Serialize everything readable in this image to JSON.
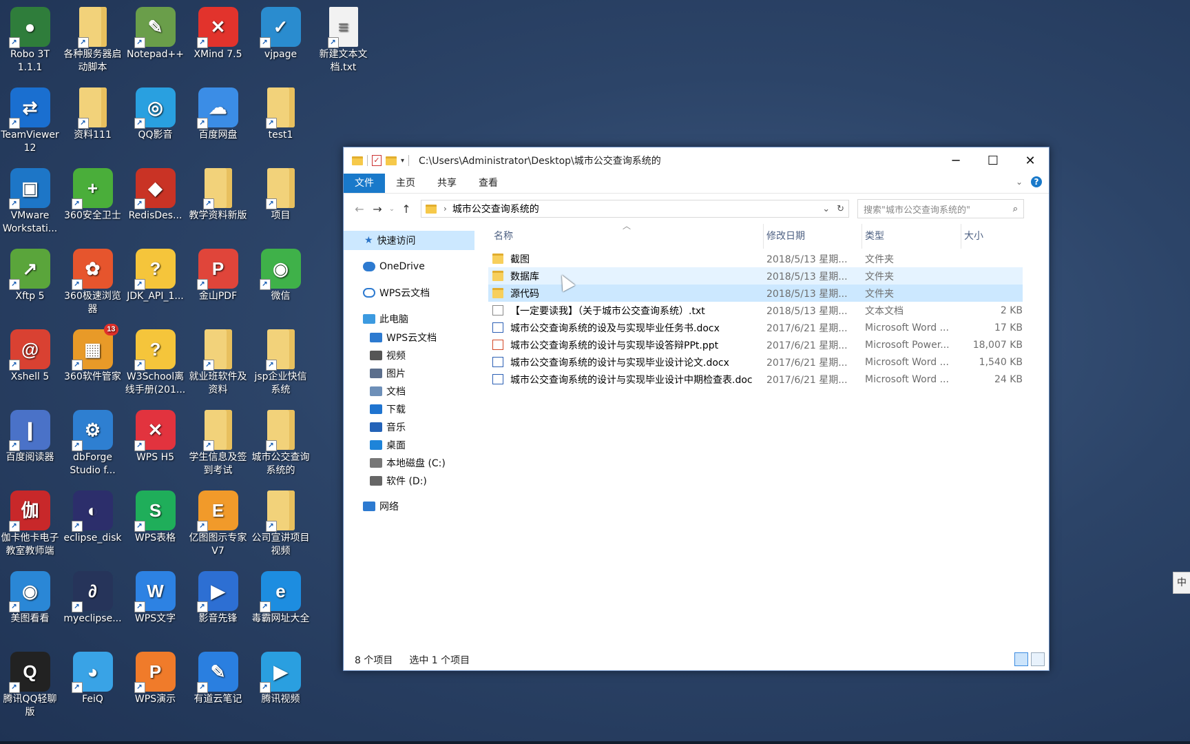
{
  "desktop": {
    "icons": [
      {
        "label": "Robo 3T\n1.1.1",
        "color": "#2f7d3b",
        "glyph": "●"
      },
      {
        "label": "各种服务器启\n动脚本",
        "color": "#f2d27a",
        "glyph": "",
        "folder": true
      },
      {
        "label": "Notepad++",
        "color": "#6a9e4a",
        "glyph": "✎"
      },
      {
        "label": "XMind 7.5",
        "color": "#e2332c",
        "glyph": "✕"
      },
      {
        "label": "vjpage",
        "color": "#2a8ccf",
        "glyph": "✓"
      },
      {
        "label": "新建文本文\n档.txt",
        "color": "#f2f2f2",
        "glyph": "≡",
        "file": true
      },
      {
        "label": "TeamViewer\n12",
        "color": "#1a6fd0",
        "glyph": "⇄"
      },
      {
        "label": "资料111",
        "color": "#f2d27a",
        "glyph": "",
        "folder": true
      },
      {
        "label": "QQ影音",
        "color": "#29a0e0",
        "glyph": "◎"
      },
      {
        "label": "百度网盘",
        "color": "#3b8de6",
        "glyph": "☁"
      },
      {
        "label": "test1",
        "color": "#f2d27a",
        "glyph": "",
        "folder": true
      },
      {
        "label": "VMware\nWorkstati...",
        "color": "#1d76c7",
        "glyph": "▣"
      },
      {
        "label": "360安全卫士",
        "color": "#4aae3a",
        "glyph": "+"
      },
      {
        "label": "RedisDes...",
        "color": "#c93325",
        "glyph": "◆"
      },
      {
        "label": "教学资料新版",
        "color": "#f2d27a",
        "glyph": "",
        "folder": true
      },
      {
        "label": "项目",
        "color": "#f2d27a",
        "glyph": "",
        "folder": true
      },
      {
        "label": "Xftp 5",
        "color": "#5aa53b",
        "glyph": "↗"
      },
      {
        "label": "360极速浏览\n器",
        "color": "#e6552d",
        "glyph": "✿"
      },
      {
        "label": "JDK_API_1...",
        "color": "#f5c53b",
        "glyph": "?"
      },
      {
        "label": "金山PDF",
        "color": "#e0453a",
        "glyph": "P"
      },
      {
        "label": "微信",
        "color": "#3fb149",
        "glyph": "◉"
      },
      {
        "label": "Xshell 5",
        "color": "#d94132",
        "glyph": "@"
      },
      {
        "label": "360软件管家",
        "color": "#e89a28",
        "glyph": "▦",
        "badge": "13"
      },
      {
        "label": "W3School离\n线手册(201...",
        "color": "#f5c53b",
        "glyph": "?"
      },
      {
        "label": "就业班软件及\n资料",
        "color": "#f2d27a",
        "glyph": "",
        "folder": true
      },
      {
        "label": "jsp企业快信\n系统",
        "color": "#f2d27a",
        "glyph": "",
        "folder": true
      },
      {
        "label": "百度阅读器",
        "color": "#4a72c8",
        "glyph": "❙"
      },
      {
        "label": "dbForge\nStudio f...",
        "color": "#2e7fd1",
        "glyph": "⚙"
      },
      {
        "label": "WPS H5",
        "color": "#e2333e",
        "glyph": "✕"
      },
      {
        "label": "学生信息及签\n到考试",
        "color": "#f2d27a",
        "glyph": "",
        "folder": true
      },
      {
        "label": "城市公交查询\n系统的",
        "color": "#f2d27a",
        "glyph": "",
        "folder": true
      },
      {
        "label": "伽卡他卡电子\n教室教师端",
        "color": "#c8282a",
        "glyph": "伽"
      },
      {
        "label": "eclipse_disk",
        "color": "#2c2e6b",
        "glyph": "◐"
      },
      {
        "label": "WPS表格",
        "color": "#1fae5a",
        "glyph": "S"
      },
      {
        "label": "亿图图示专家\nV7",
        "color": "#f19a2a",
        "glyph": "E"
      },
      {
        "label": "公司宣讲项目\n视频",
        "color": "#f2d27a",
        "glyph": "",
        "folder": true
      },
      {
        "label": "美图看看",
        "color": "#2a87d6",
        "glyph": "◉"
      },
      {
        "label": "myeclipse...",
        "color": "#26345a",
        "glyph": "∂"
      },
      {
        "label": "WPS文字",
        "color": "#2d82e3",
        "glyph": "W"
      },
      {
        "label": "影音先锋",
        "color": "#2d6fd3",
        "glyph": "▶"
      },
      {
        "label": "毒霸网址大全",
        "color": "#1d8de0",
        "glyph": "e"
      },
      {
        "label": "腾讯QQ轻聊\n版",
        "color": "#222",
        "glyph": "Q"
      },
      {
        "label": "FeiQ",
        "color": "#39a3e6",
        "glyph": "◕"
      },
      {
        "label": "WPS演示",
        "color": "#f07b2a",
        "glyph": "P"
      },
      {
        "label": "有道云笔记",
        "color": "#2a7fe0",
        "glyph": "✎"
      },
      {
        "label": "腾讯视频",
        "color": "#2a9fe0",
        "glyph": "▶"
      }
    ]
  },
  "explorer": {
    "title_path": "C:\\Users\\Administrator\\Desktop\\城市公交查询系统的",
    "ribbon_tabs": [
      "文件",
      "主页",
      "共享",
      "查看"
    ],
    "address_crumb": "城市公交查询系统的",
    "search_placeholder": "搜索\"城市公交查询系统的\"",
    "nav": {
      "quick_access": "快速访问",
      "onedrive": "OneDrive",
      "wps_cloud": "WPS云文档",
      "this_pc": "此电脑",
      "pc_items": [
        "WPS云文档",
        "视频",
        "图片",
        "文档",
        "下载",
        "音乐",
        "桌面",
        "本地磁盘 (C:)",
        "软件 (D:)"
      ],
      "network": "网络"
    },
    "columns": {
      "name": "名称",
      "date": "修改日期",
      "type": "类型",
      "size": "大小"
    },
    "files": [
      {
        "name": "截图",
        "date": "2018/5/13 星期...",
        "type": "文件夹",
        "size": "",
        "kind": "folder"
      },
      {
        "name": "数据库",
        "date": "2018/5/13 星期...",
        "type": "文件夹",
        "size": "",
        "kind": "folder"
      },
      {
        "name": "源代码",
        "date": "2018/5/13 星期...",
        "type": "文件夹",
        "size": "",
        "kind": "folder"
      },
      {
        "name": "【一定要读我】（关于城市公交查询系统）.txt",
        "date": "2018/5/13 星期...",
        "type": "文本文档",
        "size": "2 KB",
        "kind": "txt"
      },
      {
        "name": "城市公交查询系统的设及与实现毕业任务书.docx",
        "date": "2017/6/21 星期...",
        "type": "Microsoft Word ...",
        "size": "17 KB",
        "kind": "doc"
      },
      {
        "name": "城市公交查询系统的设计与实现毕设答辩PPt.ppt",
        "date": "2017/6/21 星期...",
        "type": "Microsoft Power...",
        "size": "18,007 KB",
        "kind": "ppt"
      },
      {
        "name": "城市公交查询系统的设计与实现毕业设计论文.docx",
        "date": "2017/6/21 星期...",
        "type": "Microsoft Word ...",
        "size": "1,540 KB",
        "kind": "doc"
      },
      {
        "name": "城市公交查询系统的设计与实现毕业设计中期检查表.doc",
        "date": "2017/6/21 星期...",
        "type": "Microsoft Word ...",
        "size": "24 KB",
        "kind": "doc"
      }
    ],
    "status_count": "8 个项目",
    "status_selected": "选中 1 个项目"
  },
  "ime_label": "中"
}
